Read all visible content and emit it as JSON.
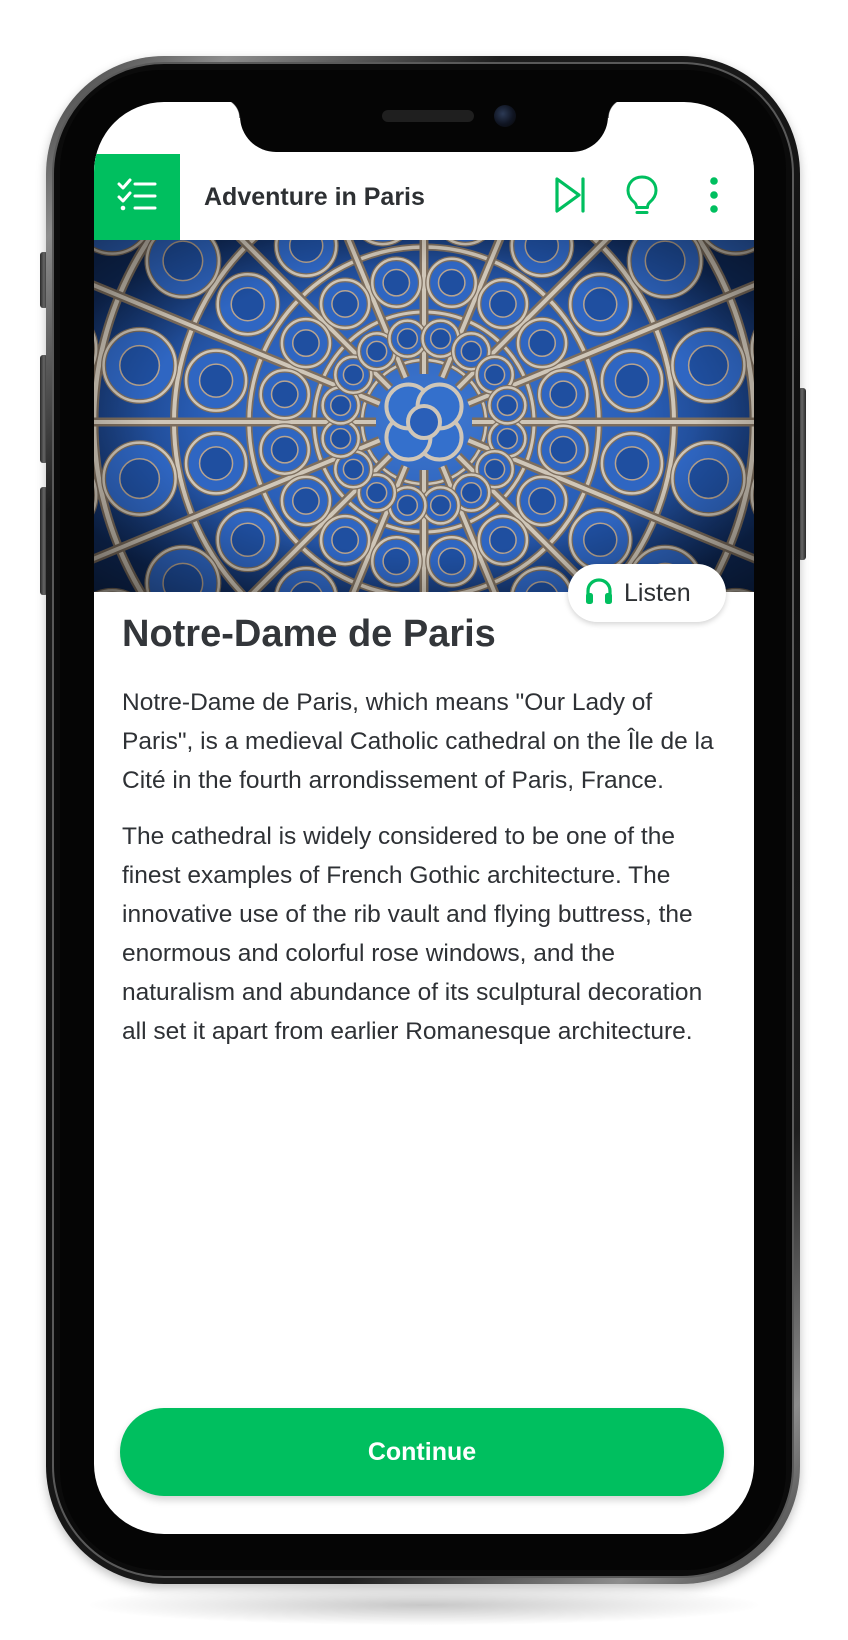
{
  "colors": {
    "accent": "#00bf5f",
    "title_text": "#2d3033",
    "body_text": "#2e3135",
    "hero_glass_blue": "#2a5fb8"
  },
  "header": {
    "menu_icon": "checklist-icon",
    "title": "Adventure in Paris",
    "actions": [
      {
        "icon": "skip-forward-icon"
      },
      {
        "icon": "lightbulb-icon"
      },
      {
        "icon": "more-vertical-icon"
      }
    ]
  },
  "hero": {
    "subject": "rose-window-stained-glass"
  },
  "listen": {
    "icon": "headphones-icon",
    "label": "Listen"
  },
  "article": {
    "title": "Notre-Dame de Paris",
    "paragraphs": [
      "Notre-Dame de Paris, which means \"Our Lady of Paris\", is a medieval Catholic cathedral on the Île de la Cité in the fourth arrondissement of Paris, France.",
      "The cathedral is widely considered to be one of the finest examples of French Gothic architecture. The innovative use of the rib vault and flying buttress, the enormous and colorful rose windows, and the naturalism and abundance of its sculptural decoration all set it apart from earlier Romanesque architecture."
    ]
  },
  "footer": {
    "continue_label": "Continue"
  }
}
